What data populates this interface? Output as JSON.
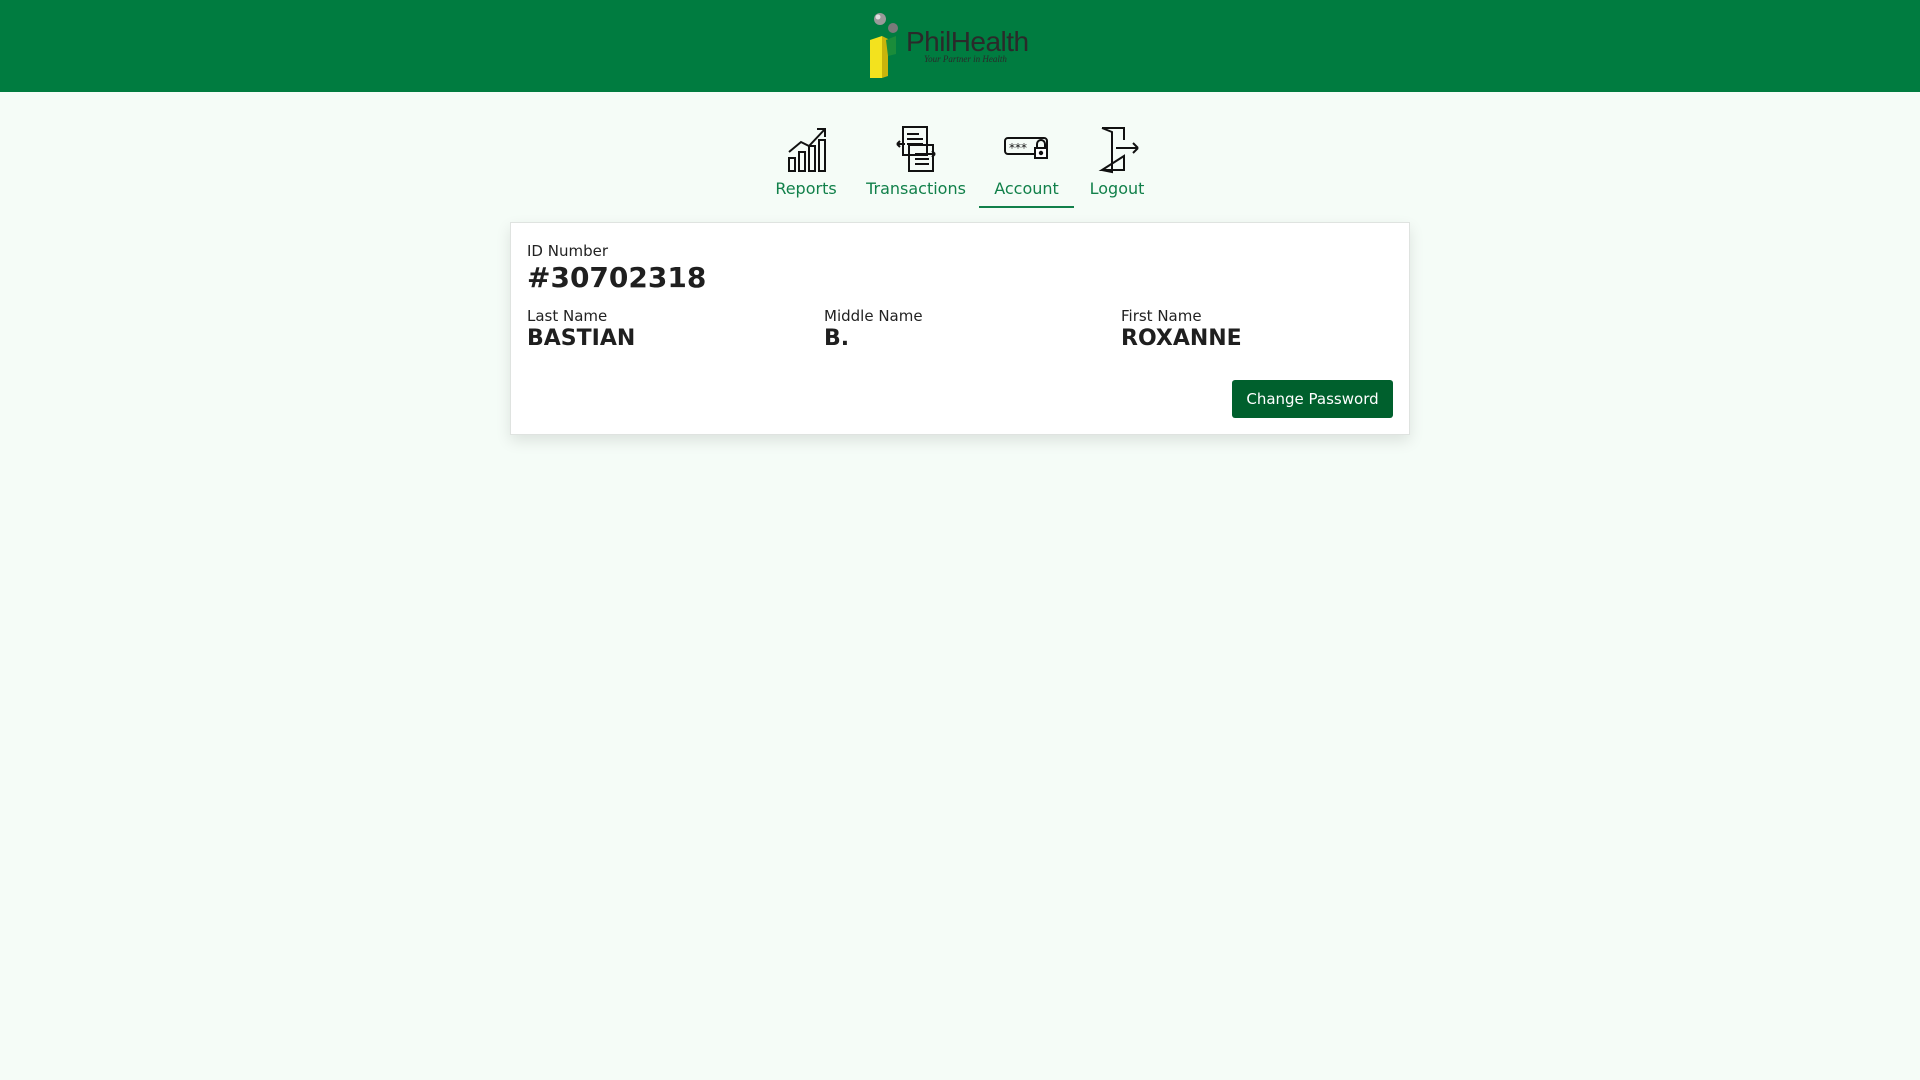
{
  "header": {
    "logo_text": "PhilHealth",
    "logo_tagline": "Your Partner in Health",
    "background_color": "#007c40"
  },
  "nav": {
    "items": [
      {
        "label": "Reports",
        "icon": "bar-chart-trend-icon"
      },
      {
        "label": "Transactions",
        "icon": "documents-exchange-icon"
      },
      {
        "label": "Account",
        "icon": "password-lock-icon",
        "active": true
      },
      {
        "label": "Logout",
        "icon": "door-exit-icon"
      }
    ],
    "color": "#11804a"
  },
  "account": {
    "id_label": "ID Number",
    "id_value": "#30702318",
    "last_name_label": "Last Name",
    "last_name_value": "BASTIAN",
    "middle_name_label": "Middle Name",
    "middle_name_value": "B.",
    "first_name_label": "First Name",
    "first_name_value": "ROXANNE",
    "change_password_label": "Change Password",
    "button_color": "#00602d"
  }
}
